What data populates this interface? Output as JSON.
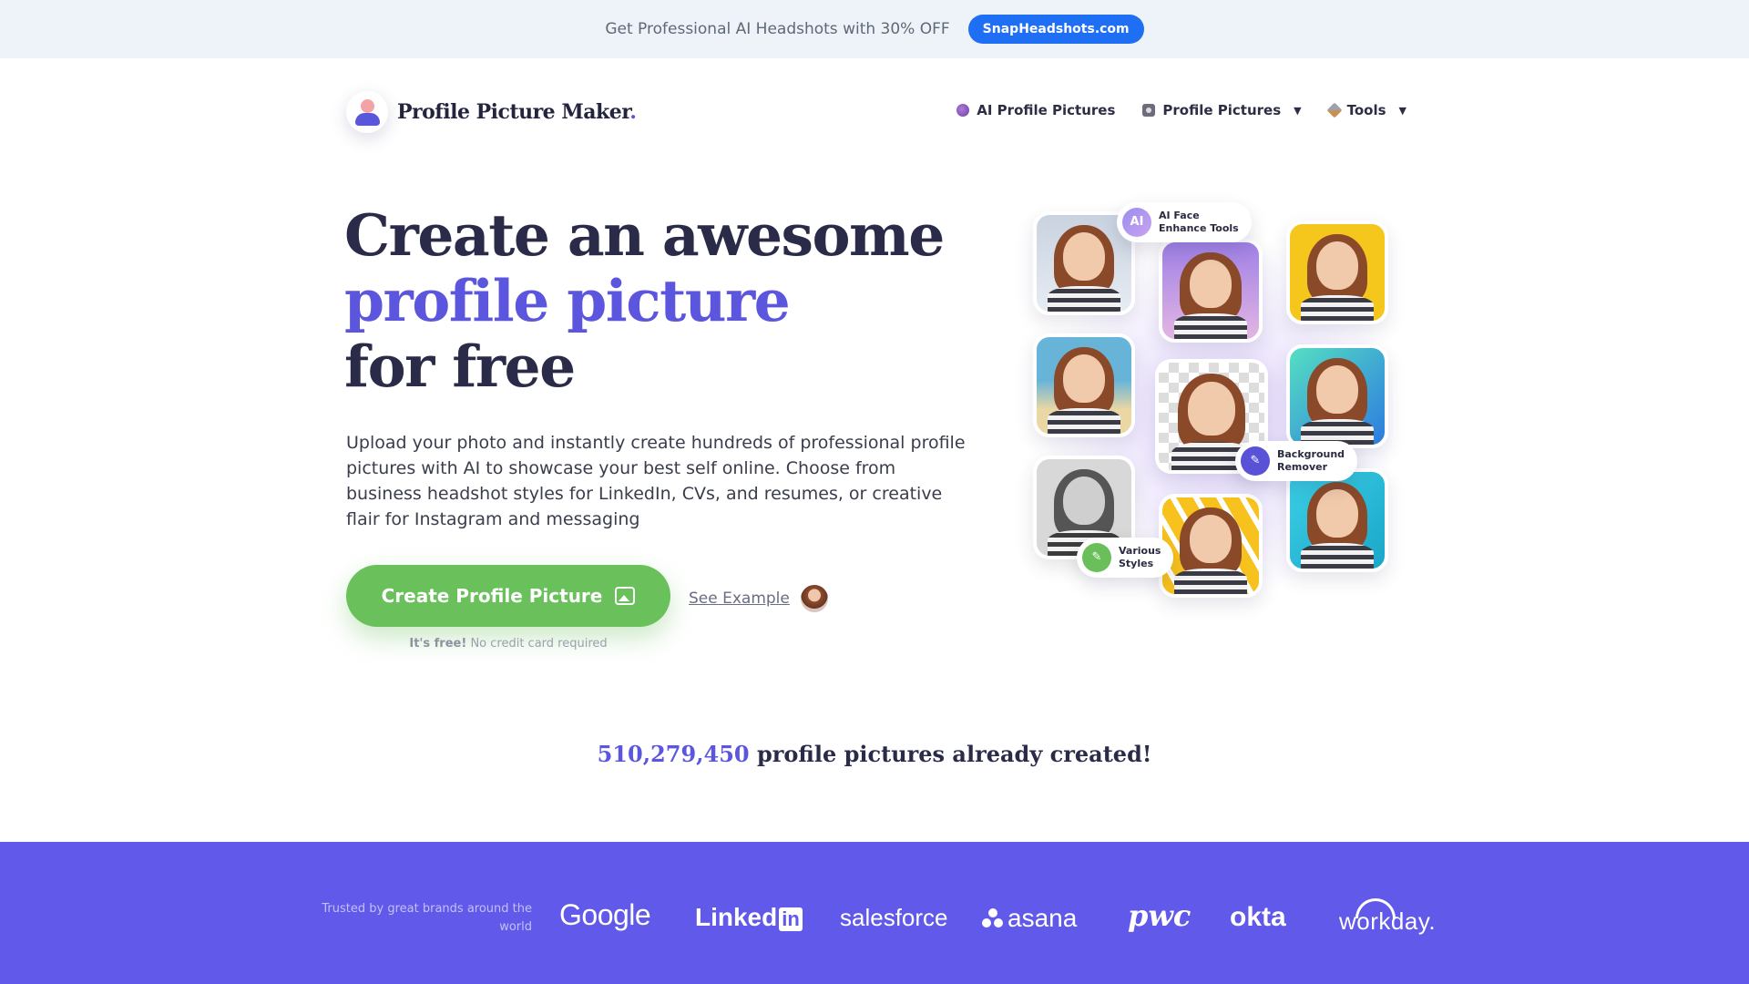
{
  "promo": {
    "text": "Get Professional AI Headshots with 30% OFF",
    "button_label": "SnapHeadshots.com"
  },
  "header": {
    "logo_text": "Profile Picture Maker",
    "logo_dot": ".",
    "nav": [
      {
        "label": "AI Profile Pictures",
        "icon": "brain-icon",
        "has_dropdown": false
      },
      {
        "label": "Profile Pictures",
        "icon": "camera-icon",
        "has_dropdown": true
      },
      {
        "label": "Tools",
        "icon": "tools-icon",
        "has_dropdown": true
      }
    ],
    "caret": "▼"
  },
  "hero": {
    "title_line1": "Create an awesome",
    "title_line2": "profile picture",
    "title_line3": "for free",
    "description": "Upload your photo and instantly create hundreds of professional profile pictures with AI to showcase your best self online. Choose from business headshot styles for LinkedIn, CVs, and resumes, or creative flair for Instagram and messaging",
    "cta_label": "Create Profile Picture",
    "see_example": "See Example",
    "free_bold": "It's free!",
    "free_rest": "No credit card required"
  },
  "collage": {
    "badges": [
      {
        "icon_text": "AI",
        "line1": "AI Face",
        "line2": "Enhance Tools"
      },
      {
        "icon_text": "✎",
        "line1": "Background",
        "line2": "Remover"
      },
      {
        "icon_text": "✎",
        "line1": "Various",
        "line2": "Styles"
      }
    ]
  },
  "counter": {
    "number": "510,279,450",
    "text": "profile pictures already created!"
  },
  "brands": {
    "caption": "Trusted by great brands around the world",
    "items": [
      "Google",
      "Linked",
      "in",
      "salesforce",
      "asana",
      "pwc",
      "okta",
      "workday."
    ]
  },
  "colors": {
    "accent": "#5c56de",
    "cta_green": "#6ac15b",
    "promo_button": "#1f6ff5",
    "brand_band": "#6059e9"
  }
}
